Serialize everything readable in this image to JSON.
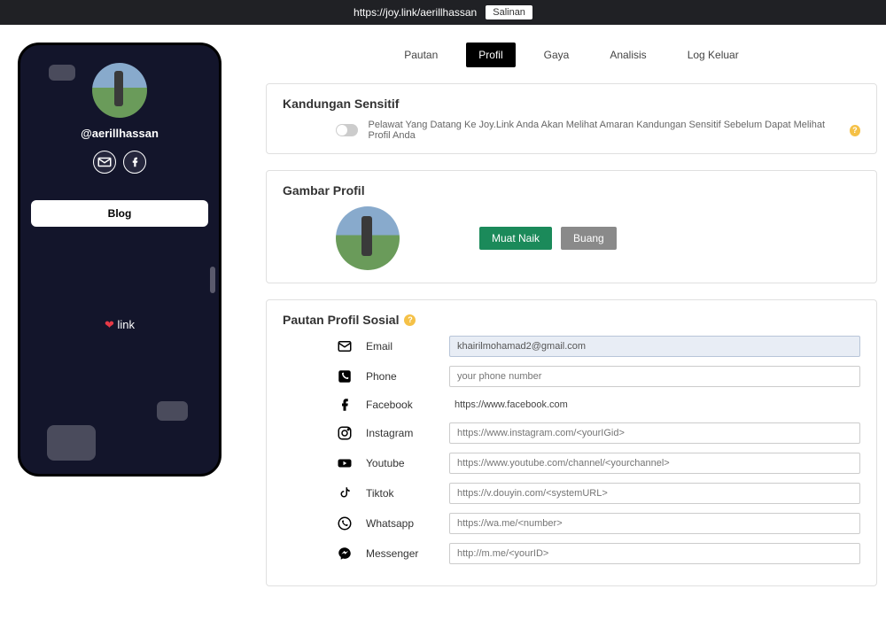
{
  "topbar": {
    "url": "https://joy.link/aerillhassan",
    "copy_label": "Salinan"
  },
  "tabs": {
    "pautan": "Pautan",
    "profil": "Profil",
    "gaya": "Gaya",
    "analisis": "Analisis",
    "logkeluar": "Log Keluar"
  },
  "phone": {
    "username": "@aerillhassan",
    "blog_label": "Blog",
    "footer_label": "link"
  },
  "sensitive": {
    "title": "Kandungan Sensitif",
    "toggle_label": "Pelawat Yang Datang Ke Joy.Link Anda Akan Melihat Amaran Kandungan Sensitif Sebelum Dapat Melihat Profil Anda"
  },
  "gambar": {
    "title": "Gambar Profil",
    "upload_label": "Muat Naik",
    "remove_label": "Buang"
  },
  "social": {
    "title": "Pautan Profil Sosial",
    "fields": {
      "email": {
        "label": "Email",
        "value": "khairilmohamad2@gmail.com"
      },
      "phone": {
        "label": "Phone",
        "placeholder": "your phone number"
      },
      "facebook": {
        "label": "Facebook",
        "static": "https://www.facebook.com"
      },
      "instagram": {
        "label": "Instagram",
        "placeholder": "https://www.instagram.com/<yourIGid>"
      },
      "youtube": {
        "label": "Youtube",
        "placeholder": "https://www.youtube.com/channel/<yourchannel>"
      },
      "tiktok": {
        "label": "Tiktok",
        "placeholder": "https://v.douyin.com/<systemURL>"
      },
      "whatsapp": {
        "label": "Whatsapp",
        "placeholder": "https://wa.me/<number>"
      },
      "messenger": {
        "label": "Messenger",
        "placeholder": "http://m.me/<yourID>"
      }
    }
  }
}
